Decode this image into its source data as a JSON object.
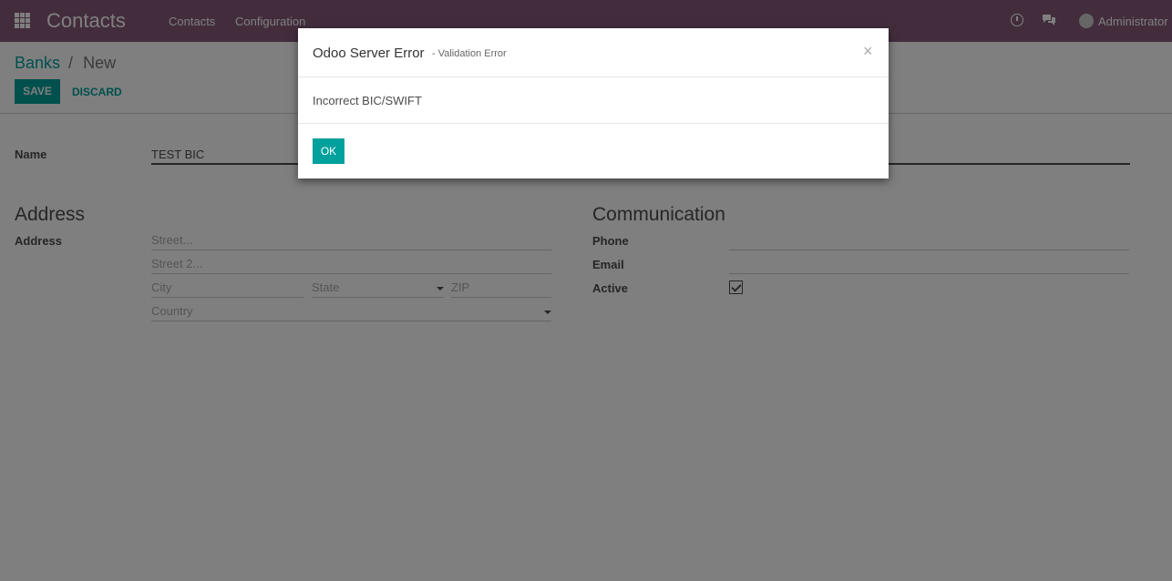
{
  "navbar": {
    "app_title": "Contacts",
    "menu": [
      "Contacts",
      "Configuration"
    ],
    "user": "Administrator"
  },
  "breadcrumb": {
    "parent": "Banks",
    "separator": "/",
    "current": "New"
  },
  "toolbar": {
    "save_label": "SAVE",
    "discard_label": "DISCARD"
  },
  "form": {
    "name_label": "Name",
    "name_value": "TEST BIC",
    "address_section": "Address",
    "address_label": "Address",
    "street_placeholder": "Street...",
    "street2_placeholder": "Street 2...",
    "city_placeholder": "City",
    "state_placeholder": "State",
    "zip_placeholder": "ZIP",
    "country_placeholder": "Country",
    "communication_section": "Communication",
    "phone_label": "Phone",
    "email_label": "Email",
    "active_label": "Active"
  },
  "dialog": {
    "title": "Odoo Server Error",
    "subtitle": "- Validation Error",
    "close": "×",
    "message": "Incorrect BIC/SWIFT",
    "ok_label": "OK"
  },
  "colors": {
    "navbar": "#875a7b",
    "accent": "#00a09d"
  }
}
